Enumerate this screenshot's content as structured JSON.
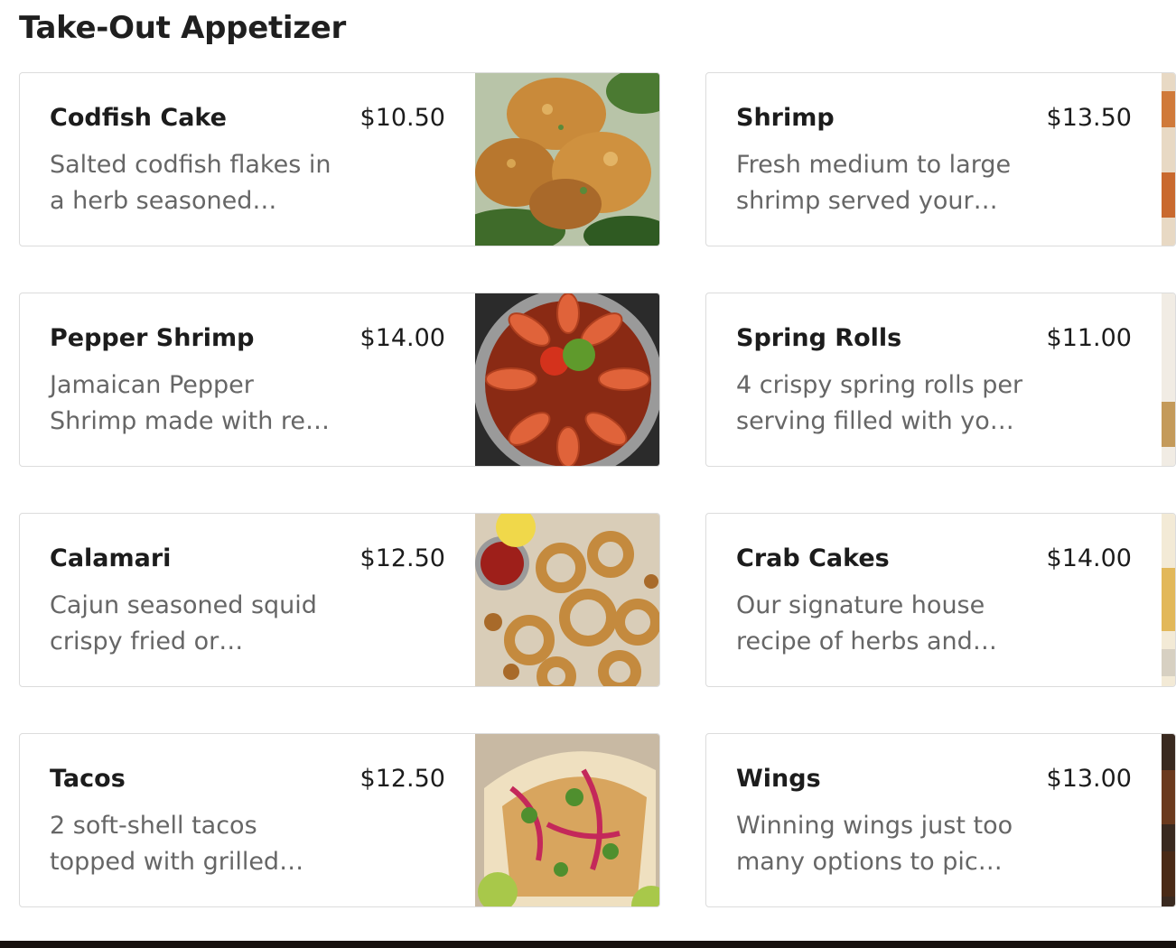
{
  "section": {
    "title": "Take-Out Appetizer"
  },
  "items": [
    {
      "name": "Codfish Cake",
      "price": "$10.50",
      "desc": "Salted codfish flakes in a herb seasoned…",
      "image": "codfish-cake-photo"
    },
    {
      "name": "Shrimp",
      "price": "$13.50",
      "desc": "Fresh medium to large shrimp served your…",
      "image": "shrimp-photo"
    },
    {
      "name": "Pepper Shrimp",
      "price": "$14.00",
      "desc": "Jamaican Pepper Shrimp made with re…",
      "image": "pepper-shrimp-photo"
    },
    {
      "name": "Spring Rolls",
      "price": "$11.00",
      "desc": "4 crispy spring rolls per serving filled with yo…",
      "image": "spring-rolls-photo"
    },
    {
      "name": "Calamari",
      "price": "$12.50",
      "desc": "Cajun seasoned squid crispy fried or…",
      "image": "calamari-photo"
    },
    {
      "name": "Crab Cakes",
      "price": "$14.00",
      "desc": "Our signature house recipe of herbs and…",
      "image": "crab-cakes-photo"
    },
    {
      "name": "Tacos",
      "price": "$12.50",
      "desc": "2 soft-shell tacos topped with grilled…",
      "image": "tacos-photo"
    },
    {
      "name": "Wings",
      "price": "$13.00",
      "desc": "Winning wings just too many options to pic…",
      "image": "wings-photo"
    }
  ]
}
